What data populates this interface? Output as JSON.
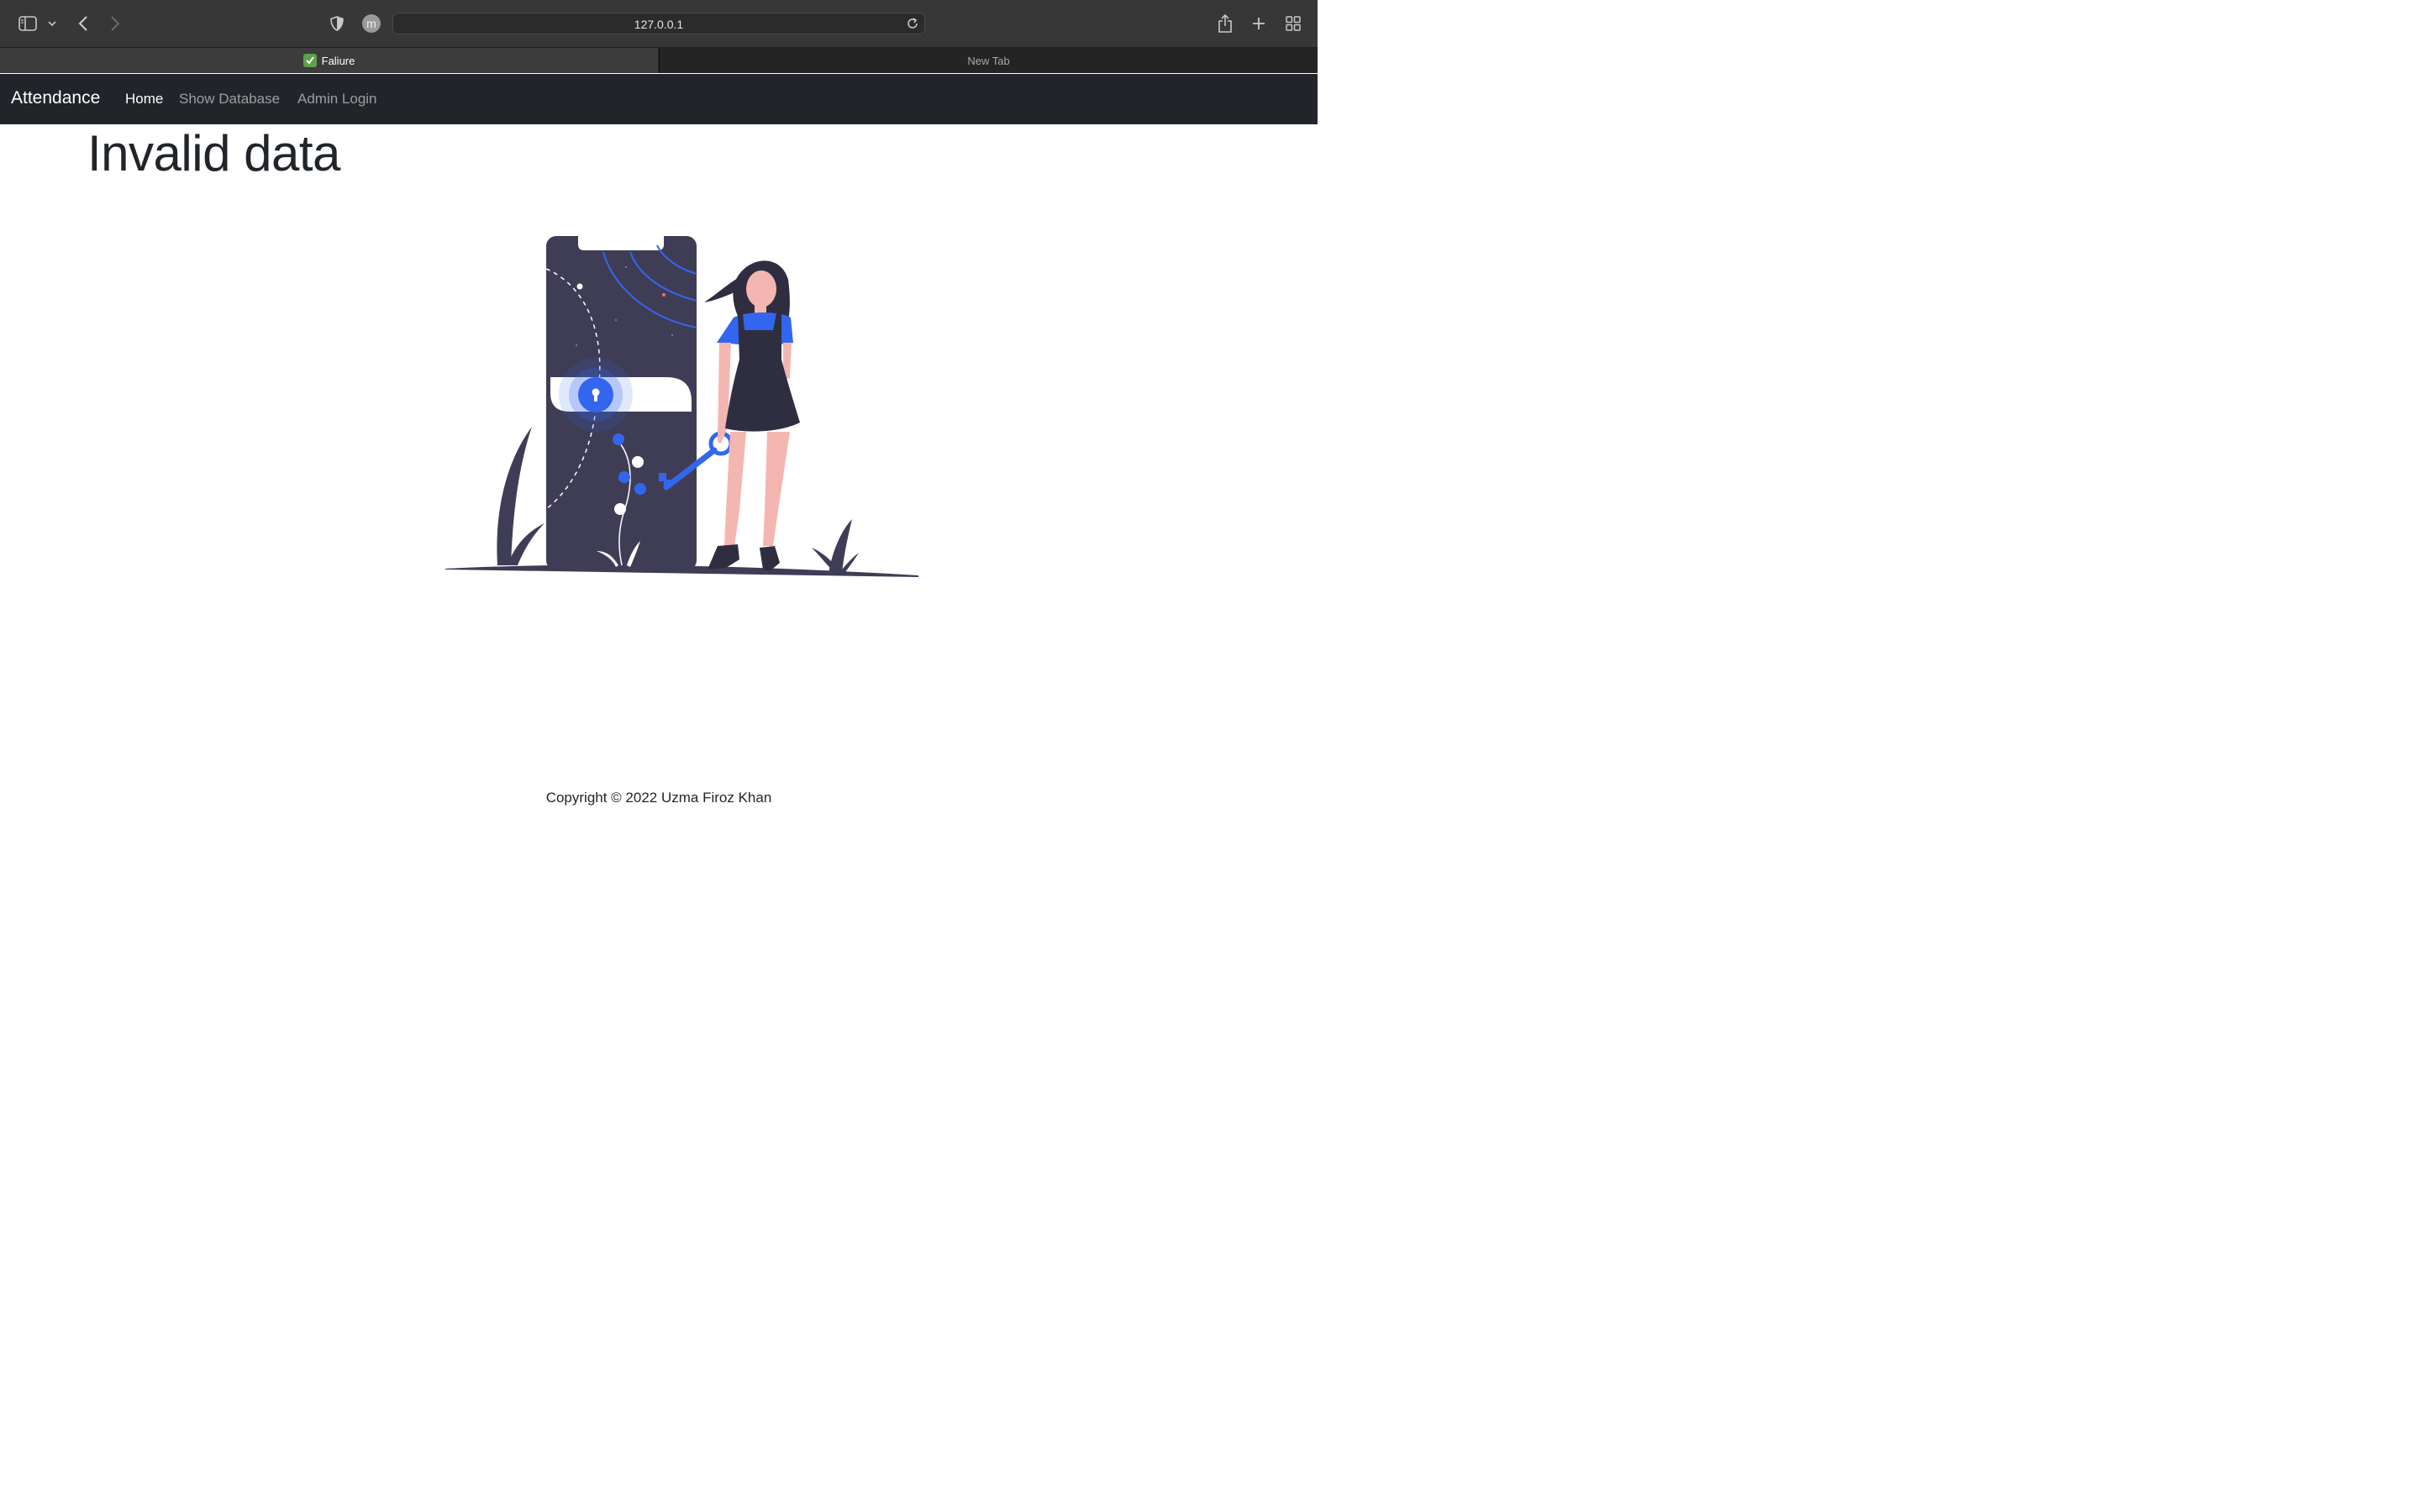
{
  "browser": {
    "url": "127.0.0.1",
    "profile_initial": "m",
    "tabs": [
      {
        "label": "Faliure",
        "active": true
      },
      {
        "label": "New Tab",
        "active": false
      }
    ],
    "icons": [
      "sidebar-icon",
      "chevron-down-icon",
      "back-icon",
      "forward-icon",
      "shield-icon",
      "profile-icon",
      "reload-icon",
      "share-icon",
      "new-tab-icon",
      "tab-overview-icon"
    ]
  },
  "navbar": {
    "brand": "Attendance",
    "links": [
      {
        "label": "Home",
        "active": true
      },
      {
        "label": "Show Database",
        "active": false
      },
      {
        "label": "Admin Login",
        "active": false
      }
    ]
  },
  "main": {
    "heading": "Invalid data",
    "illustration": "phone-lock-key-woman-illustration"
  },
  "footer": {
    "text": "Copyright © 2022   Uzma Firoz Khan"
  },
  "colors": {
    "accent": "#3366ee",
    "dark": "#3f3d56",
    "skin": "#f4b6b1",
    "navbar": "#212529"
  }
}
